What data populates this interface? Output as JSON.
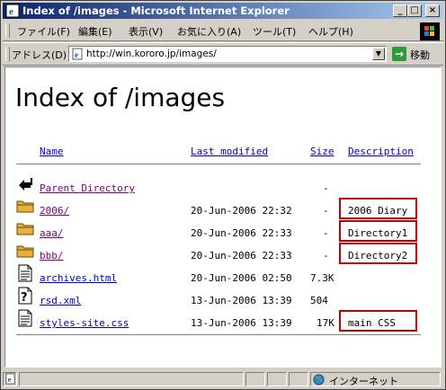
{
  "window": {
    "title": "Index of /images - Microsoft Internet Explorer",
    "buttons": {
      "minimize": "_",
      "maximize": "□",
      "close": "×"
    }
  },
  "menu": [
    "ファイル(F)",
    "編集(E)",
    "表示(V)",
    "お気に入り(A)",
    "ツール(T)",
    "ヘルプ(H)"
  ],
  "address": {
    "label": "アドレス(D)",
    "url": "http://win.kororo.jp/images/",
    "go_label": "移動"
  },
  "page": {
    "heading": "Index of /images",
    "columns": {
      "name": "Name",
      "modified": "Last modified",
      "size": "Size",
      "description": "Description"
    },
    "rows": [
      {
        "icon": "back-icon",
        "name": "Parent Directory",
        "modified": "",
        "size": "-",
        "description": ""
      },
      {
        "icon": "folder-icon",
        "name": "2006/",
        "modified": "20-Jun-2006 22:32",
        "size": "-",
        "description": "2006 Diary"
      },
      {
        "icon": "folder-icon",
        "name": "aaa/",
        "modified": "20-Jun-2006 22:33",
        "size": "-",
        "description": "Directory1"
      },
      {
        "icon": "folder-icon",
        "name": "bbb/",
        "modified": "20-Jun-2006 22:33",
        "size": "-",
        "description": "Directory2"
      },
      {
        "icon": "text-file-icon",
        "name": "archives.html",
        "modified": "20-Jun-2006 02:50",
        "size": "7.3K",
        "description": ""
      },
      {
        "icon": "unknown-file-icon",
        "name": "rsd.xml",
        "modified": "13-Jun-2006 13:39",
        "size": "504",
        "description": ""
      },
      {
        "icon": "text-file-icon",
        "name": "styles-site.css",
        "modified": "13-Jun-2006 13:39",
        "size": "17K",
        "description": "main CSS"
      }
    ]
  },
  "status": {
    "zone": "インターネット"
  }
}
